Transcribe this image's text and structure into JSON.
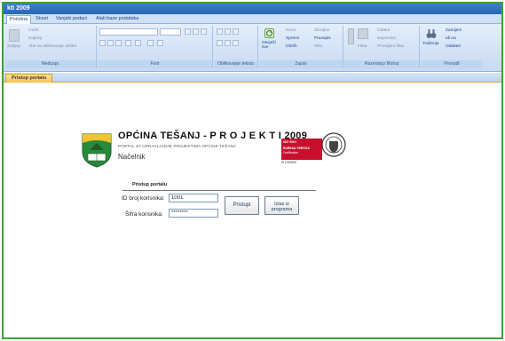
{
  "window": {
    "title": "kti 2009"
  },
  "ribbon": {
    "tabs": [
      {
        "label": "Početna",
        "active": true
      },
      {
        "label": "Stvori",
        "active": false
      },
      {
        "label": "Vanjski podaci",
        "active": false
      },
      {
        "label": "Alati baze podataka",
        "active": false
      }
    ],
    "clipboard": {
      "paste": "Zalijepi",
      "cut": "Izreži",
      "copy": "Kopiraj",
      "format_painter": "Alat za oblikovanje oblika",
      "label": "Međuspr."
    },
    "font": {
      "label": "Font"
    },
    "rich_text": {
      "label": "Oblikovanje teksta"
    },
    "records": {
      "refresh": "Osvježi sve",
      "new": "Novo",
      "save": "Spremi",
      "delete": "Izbriši",
      "totals": "Zbrojevi",
      "spelling": "Pravopis",
      "more": "Više",
      "label": "Zapisi"
    },
    "sort_filter": {
      "filter": "Filtar",
      "selection": "Odabir",
      "advanced": "Napredno",
      "toggle_filter": "Promijeni filtar",
      "label": "Razvrstaj i filtriraj"
    },
    "find": {
      "find": "Traženje",
      "replace": "Zamijeni",
      "goto": "Idi na",
      "select": "Odaberi",
      "label": "Pronađi"
    }
  },
  "document_tab": {
    "label": "Pristup portalu"
  },
  "form": {
    "title": "OPĆINA TEŠANJ - P R O J E K T I 2009",
    "subtitle": "PORTAL ZA UPRAVLJANJE PROJEKTIMA OPĆINE TEŠANJ",
    "role": "Načelnik",
    "cert": {
      "line1": "ISO 9001",
      "line2": "BUREAU VERITAS",
      "line3": "Certification",
      "line4": "W 10908/02"
    },
    "section_heading": "Pristup portalu",
    "id_label": "ID broj korisnika:",
    "id_value": "1001",
    "password_label": "Šifra korisnika:",
    "password_value": "********",
    "login_button": "Pristupi",
    "exit_button_line1": "Izlaz iz",
    "exit_button_line2": "programa"
  },
  "colors": {
    "frame": "#3aa23a",
    "titlebar": "#2766b3",
    "doc_tab": "#f5c250",
    "cert_red": "#c8102e"
  }
}
